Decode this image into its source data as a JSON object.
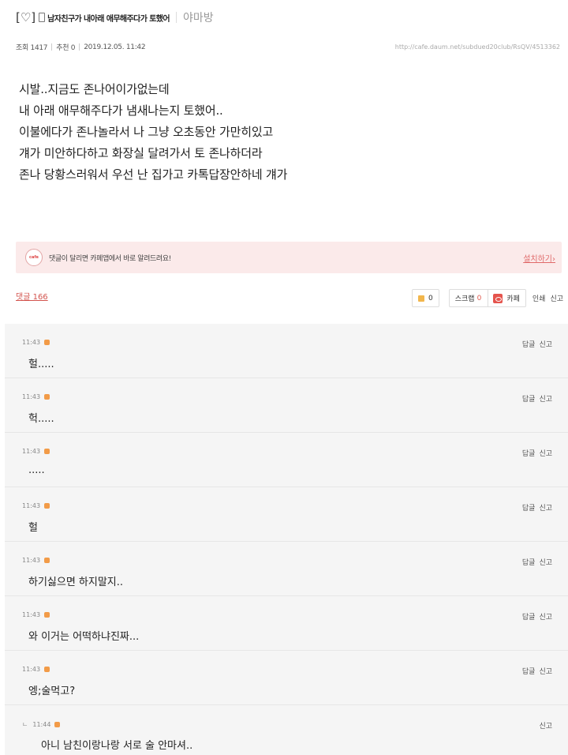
{
  "post": {
    "bracket": "[♡]",
    "title": "남자친구가 내아래 애무해주다가 토했어",
    "board": "야마방",
    "views": "조회 1417",
    "likes": "추천 0",
    "date": "2019.12.05. 11:42",
    "url": "http://cafe.daum.net/subdued20club/RsQV/4513362",
    "lines": [
      "시발..지금도 존나어이가없는데",
      "내 아래 애무해주다가 냄새나는지 토했어..",
      "이불에다가 존나놀라서 나 그냥 오초동안 가만히있고",
      "걔가 미안하다하고 화장실 달려가서 토 존나하더라",
      "존나 당황스러워서 우선 난 집가고 카톡답장안하네 걔가"
    ]
  },
  "banner": {
    "icon_label": "cafe",
    "message": "댓글이 달리면 카페앱에서 바로 알려드려요!",
    "install": "설치하기›"
  },
  "comments_header": {
    "count": "댓글 166",
    "like_count": "0",
    "scrap_label": "스크랩",
    "scrap_count": "0",
    "cafe_label": "카페",
    "print_label": "인쇄",
    "report_label": "신고"
  },
  "comments": [
    {
      "time": "11:43",
      "text": "헐.....",
      "reply": "답글",
      "report": "신고"
    },
    {
      "time": "11:43",
      "text": "헉.....",
      "reply": "답글",
      "report": "신고"
    },
    {
      "time": "11:43",
      "text": ".....",
      "reply": "답글",
      "report": "신고"
    },
    {
      "time": "11:43",
      "text": "헐",
      "reply": "답글",
      "report": "신고"
    },
    {
      "time": "11:43",
      "text": "하기싫으면 하지말지..",
      "reply": "답글",
      "report": "신고"
    },
    {
      "time": "11:43",
      "text": "와 이거는 어떡하냐진짜...",
      "reply": "답글",
      "report": "신고"
    },
    {
      "time": "11:43",
      "text": "엥;술먹고?",
      "reply": "답글",
      "report": "신고"
    },
    {
      "time": "11:44",
      "mark": "ㄴ",
      "text": "아니 남친이랑나랑 서로 술 안마셔..",
      "report": "신고"
    }
  ],
  "colors": {
    "accent": "#e05a4e",
    "comment_bg": "#f5f5f5",
    "banner_bg": "#fbeaea"
  }
}
